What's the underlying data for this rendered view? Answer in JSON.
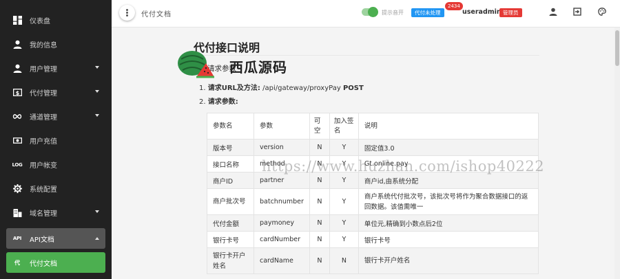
{
  "sidebar": {
    "items": [
      {
        "label": "仪表盘",
        "icon": "dashboard-icon",
        "caret": false
      },
      {
        "label": "我的信息",
        "icon": "person-icon",
        "caret": false
      },
      {
        "label": "用户管理",
        "icon": "person-icon",
        "caret": true
      },
      {
        "label": "代付管理",
        "icon": "dollar-icon",
        "caret": true
      },
      {
        "label": "通道管理",
        "icon": "infinity-icon",
        "caret": true
      },
      {
        "label": "用户充值",
        "icon": "money-icon",
        "caret": false
      },
      {
        "label": "用户帐变",
        "icon": "log-icon",
        "icon_text": "LOG",
        "caret": false
      },
      {
        "label": "系统配置",
        "icon": "gear-icon",
        "caret": false
      },
      {
        "label": "域名管理",
        "icon": "domain-icon",
        "caret": true
      }
    ],
    "open_group": {
      "label": "API文档",
      "icon_text": "API"
    },
    "active_sub": {
      "label": "代付文档",
      "icon_text": "代"
    }
  },
  "topbar": {
    "title": "代付文档",
    "sound_label": "提示音开",
    "pending_label": "代付未处理",
    "pending_count": "2434",
    "username": "useradmin",
    "role_badge": "管理员"
  },
  "colors": {
    "sidebar_bg": "#222222",
    "accent_green": "#4caf50",
    "badge_blue": "#2196f3",
    "badge_red": "#e53935"
  },
  "doc": {
    "title": "代付接口说明",
    "section": "请求参数",
    "watermark_brand": "西瓜源码",
    "watermark_url": "https://www.huzhan.com/ishop40222",
    "step1": {
      "num": "1.",
      "label": "请求URL及方法:",
      "path": "/api/gateway/proxyPay",
      "method": "POST"
    },
    "step2": {
      "num": "2.",
      "label": "请求参数:"
    },
    "table": {
      "headers": [
        "参数名",
        "参数",
        "可空",
        "加入签名",
        "说明"
      ],
      "rows": [
        [
          "版本号",
          "version",
          "N",
          "Y",
          "固定值3.0"
        ],
        [
          "接口名称",
          "method",
          "N",
          "Y",
          "Gt.online.pay"
        ],
        [
          "商户ID",
          "partner",
          "N",
          "Y",
          "商户id,由系统分配"
        ],
        [
          "商户批次号",
          "batchnumber",
          "N",
          "Y",
          "商户系统代付批次号，该批次号将作为聚合数据接口的返回数据。该值需唯一"
        ],
        [
          "代付金额",
          "paymoney",
          "N",
          "Y",
          "单位元,精确到小数点后2位"
        ],
        [
          "银行卡号",
          "cardNumber",
          "N",
          "Y",
          "银行卡号"
        ],
        [
          "银行卡开户姓名",
          "cardName",
          "N",
          "N",
          "银行卡开户姓名"
        ]
      ]
    }
  }
}
